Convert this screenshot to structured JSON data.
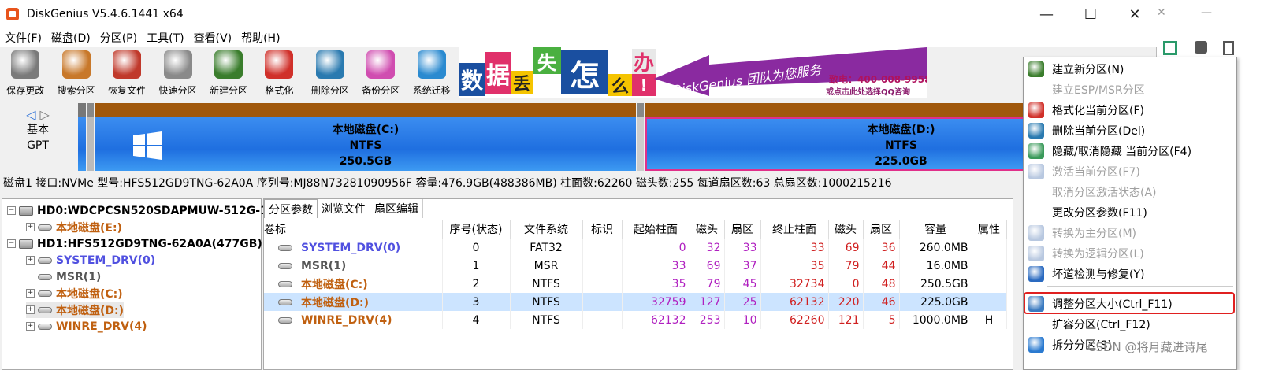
{
  "window": {
    "title": "DiskGenius V5.4.6.1441 x64",
    "minimize": "—",
    "maximize": "☐",
    "close": "✕"
  },
  "menu": [
    "文件(F)",
    "磁盘(D)",
    "分区(P)",
    "工具(T)",
    "查看(V)",
    "帮助(H)"
  ],
  "toolbar": [
    {
      "label": "保存更改",
      "icon": "save-icon",
      "color": "#7a7a7a"
    },
    {
      "label": "搜索分区",
      "icon": "search-icon",
      "color": "#c8782a"
    },
    {
      "label": "恢复文件",
      "icon": "restore-icon",
      "color": "#c0392b"
    },
    {
      "label": "快速分区",
      "icon": "disc-icon",
      "color": "#8a8a8a"
    },
    {
      "label": "新建分区",
      "icon": "new-partition-icon",
      "color": "#3a7d2c"
    },
    {
      "label": "格式化",
      "icon": "format-icon",
      "color": "#d0302a"
    },
    {
      "label": "删除分区",
      "icon": "trash-icon",
      "color": "#2a7ab0"
    },
    {
      "label": "备份分区",
      "icon": "backup-pie-icon",
      "color": "#d04db0"
    },
    {
      "label": "系统迁移",
      "icon": "migrate-icon",
      "color": "#2a8ad0"
    }
  ],
  "banner": {
    "chars": [
      "数",
      "据",
      "丢",
      "失",
      "怎",
      "么",
      "办",
      "!"
    ],
    "service": "DiskGenius 团队为您服务",
    "phone": "致电：400-008-9958",
    "qq": "或点击此处选择QQ咨询"
  },
  "disk_side": {
    "line1": "基本",
    "line2": "GPT"
  },
  "partitions_map": [
    {
      "name": "本地磁盘(C:)",
      "fs": "NTFS",
      "size": "250.5GB"
    },
    {
      "name": "本地磁盘(D:)",
      "fs": "NTFS",
      "size": "225.0GB"
    }
  ],
  "info_bar": "磁盘1 接口:NVMe  型号:HFS512GD9TNG-62A0A  序列号:MJ88N73281090956F  容量:476.9GB(488386MB)  柱面数:62260  磁头数:255  每道扇区数:63  总扇区数:1000215216",
  "tree": [
    {
      "label": "HD0:WDCPCSN520SDAPMUW-512G-1",
      "kind": "disk",
      "level": 0,
      "color": "#000"
    },
    {
      "label": "本地磁盘(E:)",
      "kind": "part",
      "level": 1,
      "color": "#c06010"
    },
    {
      "label": "HD1:HFS512GD9TNG-62A0A(477GB)",
      "kind": "disk",
      "level": 0,
      "color": "#000"
    },
    {
      "label": "SYSTEM_DRV(0)",
      "kind": "part",
      "level": 1,
      "color": "#5050e0"
    },
    {
      "label": "MSR(1)",
      "kind": "part",
      "level": 1,
      "color": "#555"
    },
    {
      "label": "本地磁盘(C:)",
      "kind": "part",
      "level": 1,
      "color": "#c06010"
    },
    {
      "label": "本地磁盘(D:)",
      "kind": "part",
      "level": 1,
      "color": "#c06010"
    },
    {
      "label": "WINRE_DRV(4)",
      "kind": "part",
      "level": 1,
      "color": "#c06010"
    }
  ],
  "tabs": [
    "分区参数",
    "浏览文件",
    "扇区编辑"
  ],
  "table": {
    "headers": [
      "卷标",
      "序号(状态)",
      "文件系统",
      "标识",
      "起始柱面",
      "磁头",
      "扇区",
      "终止柱面",
      "磁头",
      "扇区",
      "容量",
      "属性"
    ],
    "rows": [
      {
        "label": "SYSTEM_DRV(0)",
        "color": "#5050e0",
        "idx": "0",
        "fs": "FAT32",
        "flag": "",
        "sc": "0",
        "sh": "32",
        "ss": "33",
        "ec": "33",
        "eh": "69",
        "es": "36",
        "cap": "260.0MB",
        "attr": ""
      },
      {
        "label": "MSR(1)",
        "color": "#555555",
        "idx": "1",
        "fs": "MSR",
        "flag": "",
        "sc": "33",
        "sh": "69",
        "ss": "37",
        "ec": "35",
        "eh": "79",
        "es": "44",
        "cap": "16.0MB",
        "attr": ""
      },
      {
        "label": "本地磁盘(C:)",
        "color": "#c06010",
        "idx": "2",
        "fs": "NTFS",
        "flag": "",
        "sc": "35",
        "sh": "79",
        "ss": "45",
        "ec": "32734",
        "eh": "0",
        "es": "48",
        "cap": "250.5GB",
        "attr": ""
      },
      {
        "label": "本地磁盘(D:)",
        "color": "#c06010",
        "idx": "3",
        "fs": "NTFS",
        "flag": "",
        "sc": "32759",
        "sh": "127",
        "ss": "25",
        "ec": "62132",
        "eh": "220",
        "es": "46",
        "cap": "225.0GB",
        "attr": ""
      },
      {
        "label": "WINRE_DRV(4)",
        "color": "#c06010",
        "idx": "4",
        "fs": "NTFS",
        "flag": "",
        "sc": "62132",
        "sh": "253",
        "ss": "10",
        "ec": "62260",
        "eh": "121",
        "es": "5",
        "cap": "1000.0MB",
        "attr": "H"
      }
    ],
    "selected_row": 3
  },
  "context_menu": [
    {
      "label": "建立新分区(N)",
      "enabled": true,
      "icon": "new-partition-icon",
      "color": "#3a7d2c"
    },
    {
      "label": "建立ESP/MSR分区",
      "enabled": false,
      "icon": "",
      "color": ""
    },
    {
      "label": "格式化当前分区(F)",
      "enabled": true,
      "icon": "format-icon",
      "color": "#d0302a"
    },
    {
      "label": "删除当前分区(Del)",
      "enabled": true,
      "icon": "trash-icon",
      "color": "#2a7ab0"
    },
    {
      "label": "隐藏/取消隐藏 当前分区(F4)",
      "enabled": true,
      "icon": "hide-icon",
      "color": "#3a9a5a"
    },
    {
      "label": "激活当前分区(F7)",
      "enabled": false,
      "icon": "activate-icon",
      "color": "#b8c8e0"
    },
    {
      "label": "取消分区激活状态(A)",
      "enabled": false,
      "icon": "",
      "color": ""
    },
    {
      "label": "更改分区参数(F11)",
      "enabled": true,
      "icon": "",
      "color": ""
    },
    {
      "label": "转换为主分区(M)",
      "enabled": false,
      "icon": "convert-primary-icon",
      "color": "#b8c8e0"
    },
    {
      "label": "转换为逻辑分区(L)",
      "enabled": false,
      "icon": "convert-logical-icon",
      "color": "#b8c8e0"
    },
    {
      "label": "坏道检测与修复(Y)",
      "enabled": true,
      "icon": "wrench-icon",
      "color": "#2a6ac0"
    },
    {
      "label": "调整分区大小(Ctrl_F11)",
      "enabled": true,
      "icon": "resize-icon",
      "color": "#3a7ac0"
    },
    {
      "label": "扩容分区(Ctrl_F12)",
      "enabled": true,
      "icon": "",
      "color": ""
    },
    {
      "label": "拆分分区(S)",
      "enabled": true,
      "icon": "split-icon",
      "color": "#2a7ad0"
    }
  ],
  "watermark": "CSDN @将月藏进诗尾"
}
